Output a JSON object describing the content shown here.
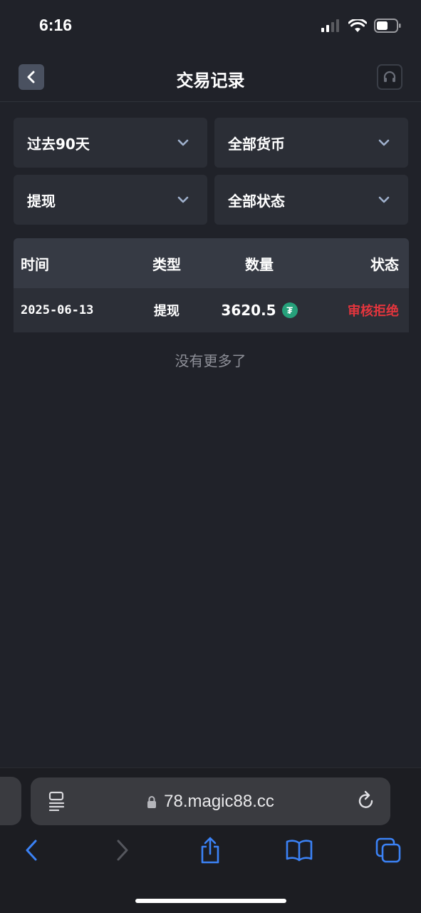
{
  "status_bar": {
    "time": "6:16"
  },
  "header": {
    "title": "交易记录"
  },
  "filters": [
    {
      "label": "过去90天"
    },
    {
      "label": "全部货币"
    },
    {
      "label": "提现"
    },
    {
      "label": "全部状态"
    }
  ],
  "table": {
    "columns": [
      "时间",
      "类型",
      "数量",
      "状态"
    ],
    "rows": [
      {
        "time": "2025-06-13",
        "type": "提现",
        "amount": "3620.5",
        "currency_icon": "tether-icon",
        "status": "审核拒绝",
        "status_color": "#e4353d"
      }
    ],
    "footer": "没有更多了"
  },
  "browser": {
    "url": "78.magic88.cc"
  },
  "colors": {
    "background": "#202229",
    "panel": "#2b2e36",
    "header_row": "#363a44",
    "rejected": "#e4353d",
    "tether": "#26a17b"
  }
}
